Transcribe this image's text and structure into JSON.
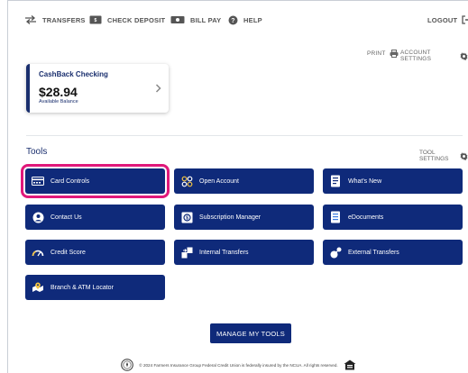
{
  "nav": {
    "transfers": "TRANSFERS",
    "check_deposit": "CHECK DEPOSIT",
    "bill_pay": "BILL PAY",
    "help": "HELP",
    "logout": "LOGOUT"
  },
  "utilities": {
    "print": "PRINT",
    "account_settings": "ACCOUNT SETTINGS"
  },
  "account": {
    "name": "CashBack Checking",
    "balance": "$28.94",
    "balance_label": "Available Balance"
  },
  "tools": {
    "title": "Tools",
    "settings": "TOOL SETTINGS",
    "items": [
      {
        "label": "Card Controls",
        "icon": "card-icon",
        "selected": true
      },
      {
        "label": "Open Account",
        "icon": "open-account-icon"
      },
      {
        "label": "What's New",
        "icon": "whats-new-icon"
      },
      {
        "label": "Contact Us",
        "icon": "contact-icon"
      },
      {
        "label": "Subscription Manager",
        "icon": "subscription-icon"
      },
      {
        "label": "eDocuments",
        "icon": "edocuments-icon"
      },
      {
        "label": "Credit Score",
        "icon": "gauge-icon"
      },
      {
        "label": "Internal Transfers",
        "icon": "internal-transfer-icon"
      },
      {
        "label": "External Transfers",
        "icon": "external-transfer-icon"
      },
      {
        "label": "Branch & ATM Locator",
        "icon": "map-pin-icon"
      }
    ],
    "manage": "MANAGE MY TOOLS"
  },
  "footer": {
    "text": "© 2024 Farmers Insurance Group Federal Credit Union is federally insured by the NCUA. All rights reserved."
  },
  "colors": {
    "brand_navy": "#0f2a7a",
    "highlight": "#e0187a"
  }
}
